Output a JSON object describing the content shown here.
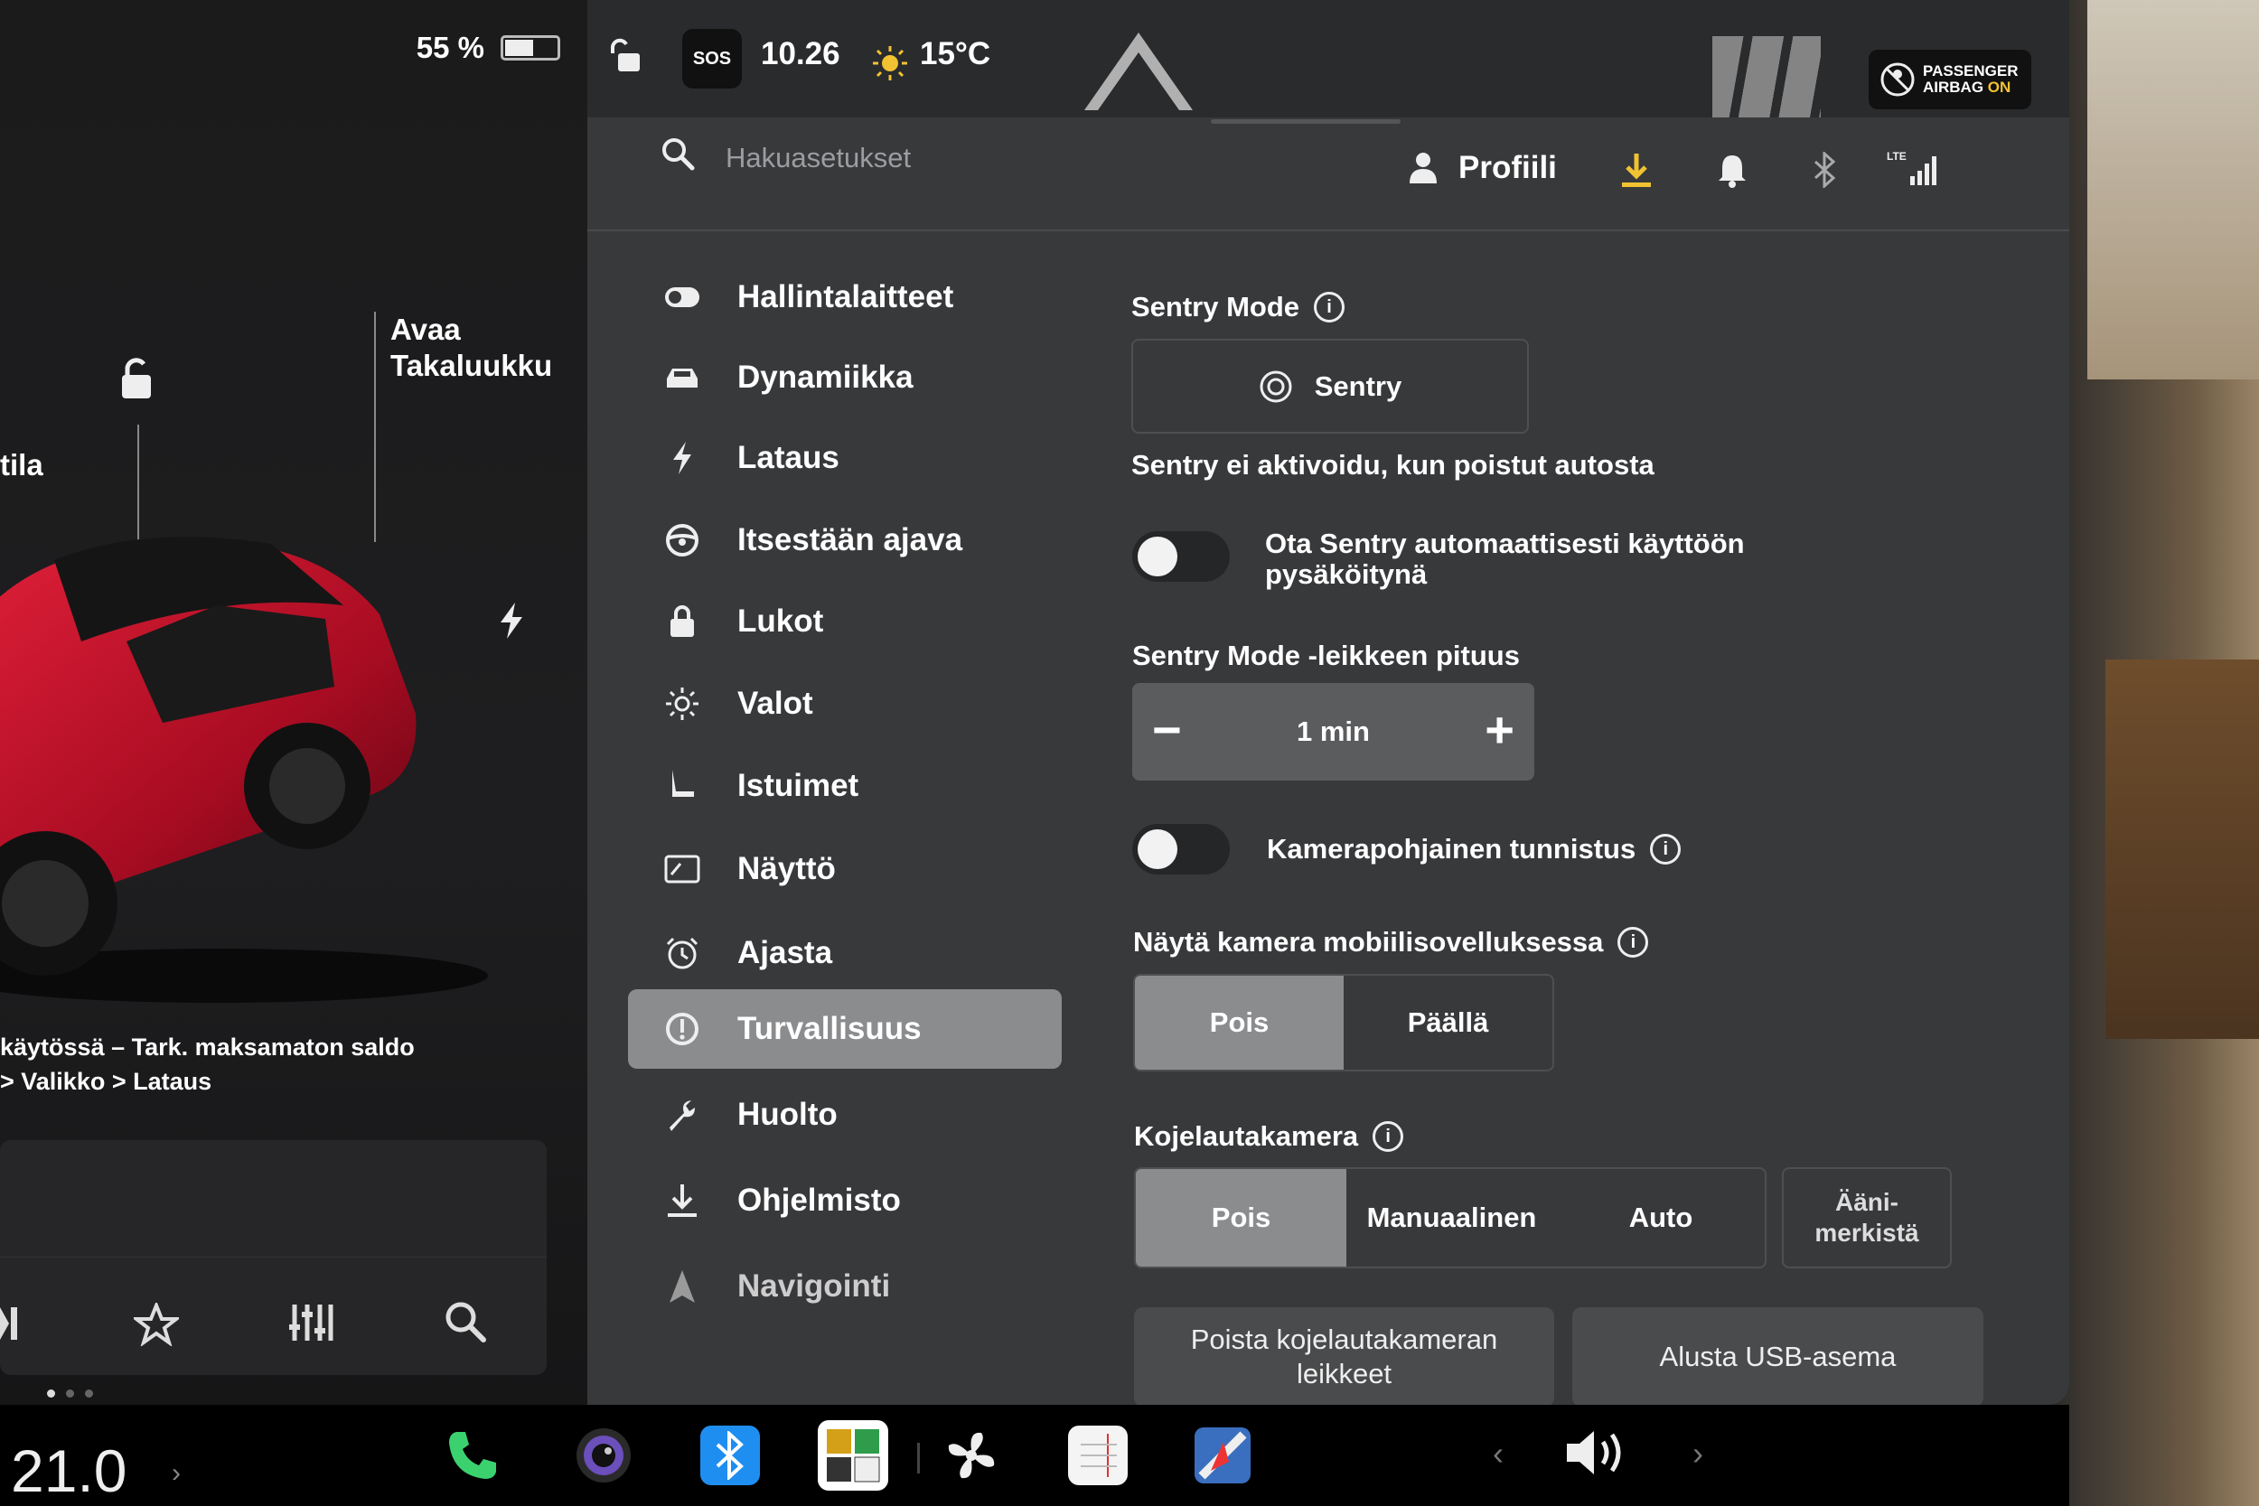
{
  "status": {
    "battery_percent_label": "55 %",
    "battery_level": 0.55,
    "sos_label": "SOS",
    "time": "10.26",
    "temperature": "15°C",
    "airbag_line1": "PASSENGER",
    "airbag_line2_prefix": "AIRBAG",
    "airbag_line2_state": "ON"
  },
  "car_panel": {
    "trunk_label_line1": "Avaa",
    "trunk_label_line2": "Takaluukku",
    "frunk_label_partial": "tila",
    "warning_line1": "käytössä – Tark. maksamaton saldo",
    "warning_line2": "> Valikko > Lataus"
  },
  "search": {
    "placeholder": "Hakuasetukset"
  },
  "header": {
    "profile_label": "Profiili"
  },
  "sidebar": {
    "items": [
      {
        "label": "Hallintalaitteet",
        "icon": "toggle-icon"
      },
      {
        "label": "Dynamiikka",
        "icon": "car-icon"
      },
      {
        "label": "Lataus",
        "icon": "bolt-icon"
      },
      {
        "label": "Itsestään ajava",
        "icon": "steering-wheel-icon"
      },
      {
        "label": "Lukot",
        "icon": "lock-icon"
      },
      {
        "label": "Valot",
        "icon": "sun-icon"
      },
      {
        "label": "Istuimet",
        "icon": "seat-icon"
      },
      {
        "label": "Näyttö",
        "icon": "display-icon"
      },
      {
        "label": "Ajasta",
        "icon": "alarm-clock-icon"
      },
      {
        "label": "Turvallisuus",
        "icon": "alert-circle-icon",
        "active": true
      },
      {
        "label": "Huolto",
        "icon": "wrench-icon"
      },
      {
        "label": "Ohjelmisto",
        "icon": "download-icon"
      },
      {
        "label": "Navigointi",
        "icon": "navigation-icon"
      }
    ]
  },
  "content": {
    "sentry_title": "Sentry Mode",
    "sentry_button": "Sentry",
    "sentry_desc": "Sentry ei aktivoidu, kun poistut autosta",
    "auto_sentry_label_line1": "Ota Sentry automaattisesti käyttöön",
    "auto_sentry_label_line2": "pysäköitynä",
    "clip_length_title": "Sentry Mode -leikkeen pituus",
    "clip_length_value": "1 min",
    "camera_detection_label": "Kamerapohjainen tunnistus",
    "mobile_camera_title": "Näytä kamera mobiilisovelluksessa",
    "mobile_camera_options": [
      "Pois",
      "Päällä"
    ],
    "mobile_camera_selected": "Pois",
    "dashcam_title": "Kojelautakamera",
    "dashcam_options": [
      "Pois",
      "Manuaalinen",
      "Auto"
    ],
    "dashcam_selected": "Pois",
    "sound_button_line1": "Ääni-",
    "sound_button_line2": "merkistä",
    "delete_clips_line1": "Poista kojelautakameran",
    "delete_clips_line2": "leikkeet",
    "format_usb": "Alusta USB-asema"
  },
  "taskbar": {
    "temperature": "21.0",
    "apps": [
      "phone-icon",
      "camera-icon",
      "bluetooth-icon",
      "toybox-icon",
      "fan-icon",
      "notepad-icon",
      "navigation-app-icon"
    ]
  },
  "colors": {
    "panel_bg": "#38393b",
    "selected": "#8b8c8e",
    "accent_yellow": "#f1c232",
    "bluetooth_blue": "#1f8ef1",
    "phone_green": "#3bd16f",
    "car_red": "#c8102e"
  }
}
